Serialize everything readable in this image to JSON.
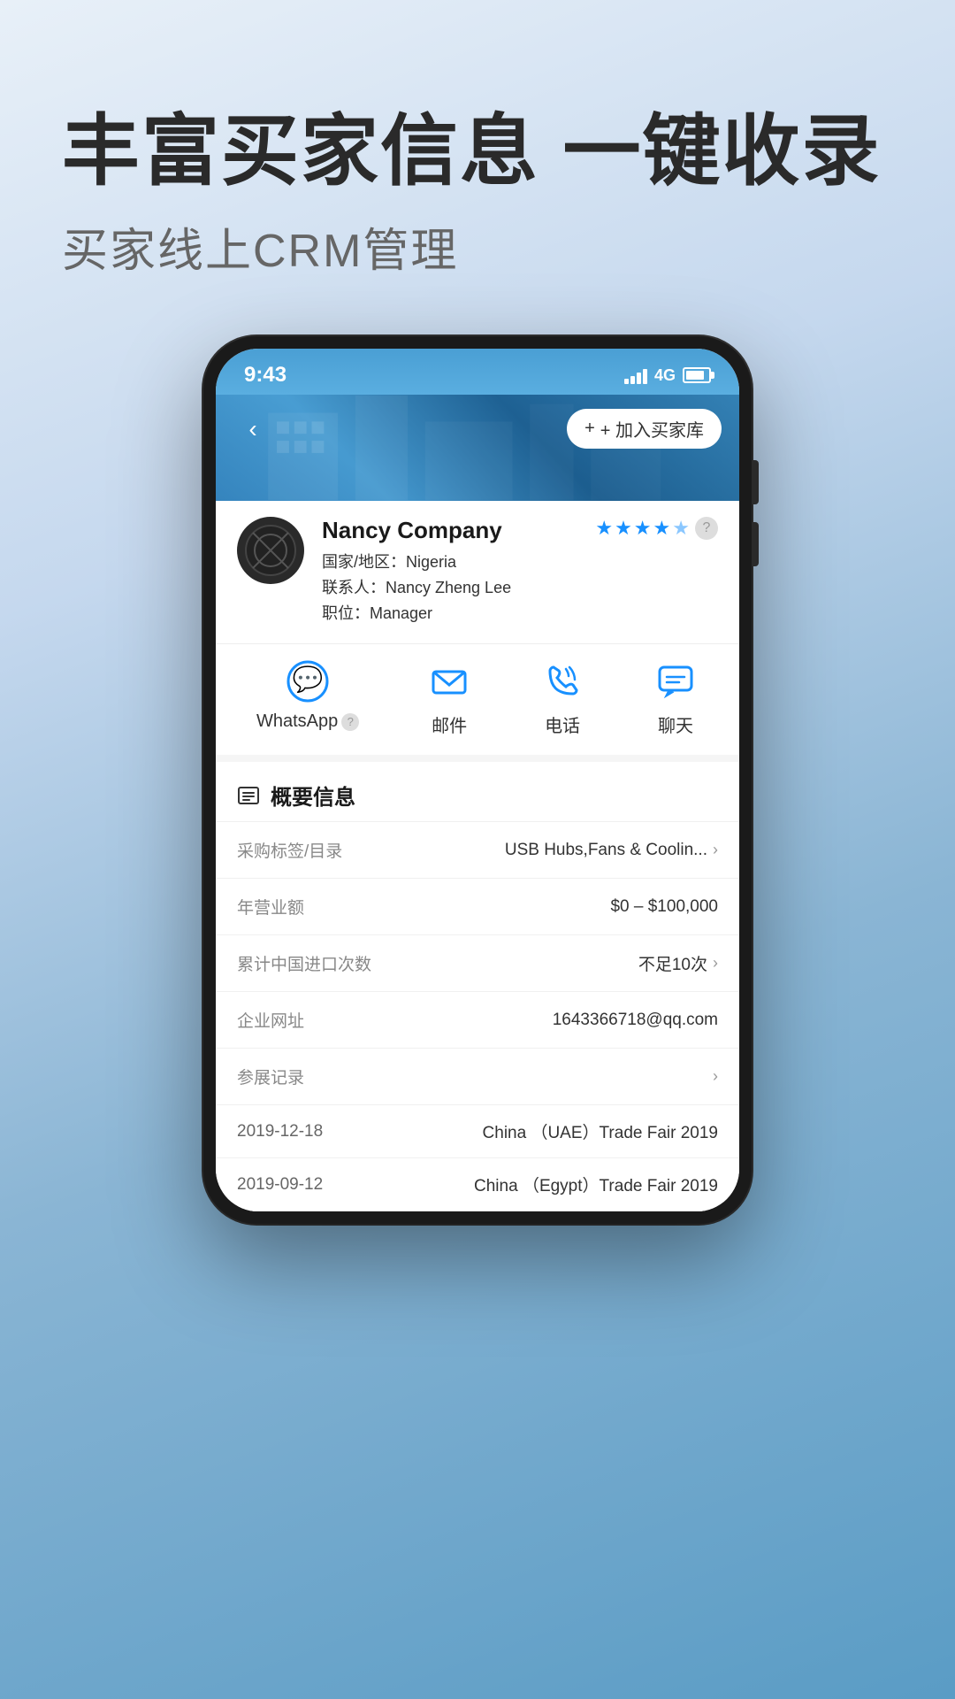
{
  "page": {
    "main_title": "丰富买家信息 一键收录",
    "sub_title": "买家线上CRM管理"
  },
  "phone": {
    "status_bar": {
      "time": "9:43",
      "signal": "4G"
    },
    "nav": {
      "add_buyer_btn": "+ 加入买家库"
    },
    "company": {
      "name": "Nancy Company",
      "country_label": "国家/地区：",
      "country": "Nigeria",
      "contact_label": "联系人：",
      "contact": "Nancy Zheng Lee",
      "position_label": "职位：",
      "position": "Manager",
      "stars": 4.5
    },
    "actions": [
      {
        "id": "whatsapp",
        "label": "WhatsApp",
        "has_help": true
      },
      {
        "id": "email",
        "label": "邮件",
        "has_help": false
      },
      {
        "id": "phone",
        "label": "电话",
        "has_help": false
      },
      {
        "id": "chat",
        "label": "聊天",
        "has_help": false
      }
    ],
    "overview": {
      "title": "概要信息",
      "items": [
        {
          "label": "采购标签/目录",
          "value": "USB Hubs,Fans & Coolin...",
          "has_chevron": true
        },
        {
          "label": "年营业额",
          "value": "$0 – $100,000",
          "has_chevron": false
        },
        {
          "label": "累计中国进口次数",
          "value": "不足10次",
          "has_chevron": true
        },
        {
          "label": "企业网址",
          "value": "1643366718@qq.com",
          "has_chevron": false
        },
        {
          "label": "参展记录",
          "value": "",
          "has_chevron": true
        }
      ],
      "trade_fairs": [
        {
          "date": "2019-12-18",
          "name": "China （UAE）Trade Fair 2019"
        },
        {
          "date": "2019-09-12",
          "name": "China （Egypt）Trade Fair 2019"
        }
      ]
    }
  },
  "colors": {
    "blue_accent": "#1890ff",
    "header_blue": "#4a9fd4",
    "text_dark": "#1a1a1a",
    "text_gray": "#888888"
  }
}
